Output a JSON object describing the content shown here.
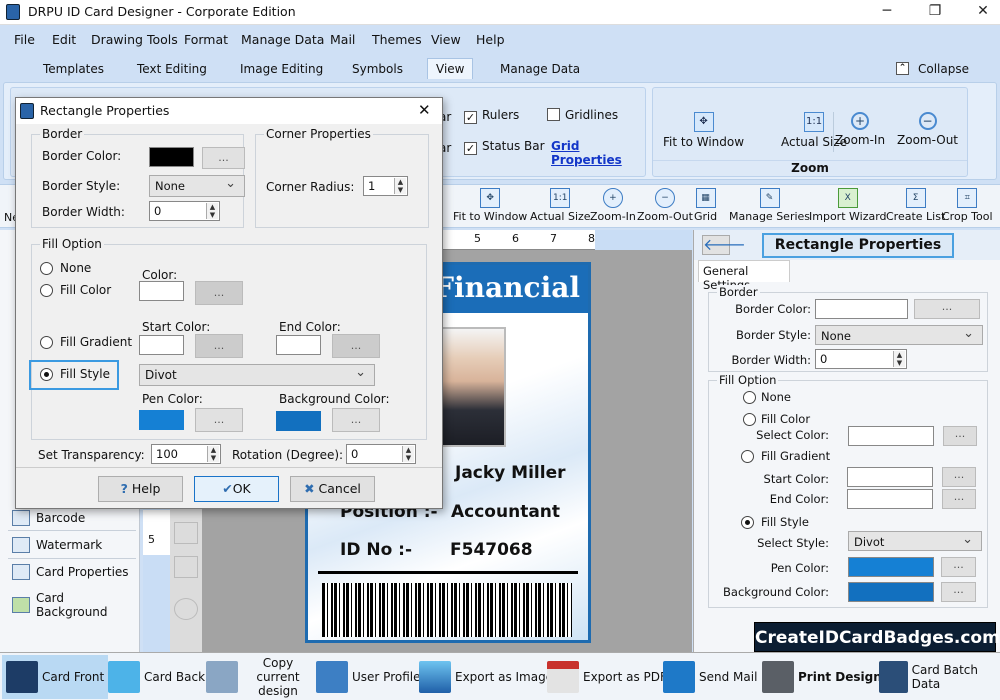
{
  "window": {
    "title": "DRPU ID Card Designer - Corporate Edition",
    "minimize": "─",
    "maximize": "❐",
    "close": "✕"
  },
  "menu": [
    "File",
    "Edit",
    "Drawing Tools",
    "Format",
    "Manage Data",
    "Mail",
    "Themes",
    "View",
    "Help"
  ],
  "tabs": [
    "Templates",
    "Text Editing",
    "Image Editing",
    "Symbols",
    "View",
    "Manage Data"
  ],
  "active_tab": "View",
  "collapse_label": "Collapse",
  "ribbon": {
    "view_group": {
      "partial_1": "ar",
      "partial_2": "ar",
      "rulers": {
        "label": "Rulers",
        "checked": true
      },
      "gridlines": {
        "label": "Gridlines",
        "checked": false
      },
      "status_bar": {
        "label": "Status Bar",
        "checked": true
      },
      "grid_properties": "Grid Properties"
    },
    "zoom_group": {
      "title": "Zoom",
      "buttons": [
        "Fit to Window",
        "Actual Size",
        "Zoom-In",
        "Zoom-Out"
      ]
    }
  },
  "toolbar": {
    "partial_left": "Ne",
    "items": [
      "Fit to Window",
      "Actual Size",
      "Zoom-In",
      "Zoom-Out",
      "Grid",
      "Manage Series",
      "Import Wizard",
      "Create List",
      "Crop Tool"
    ]
  },
  "left_panel": {
    "items": [
      "Barcode",
      "Watermark",
      "Card Properties",
      "Card Background"
    ]
  },
  "ruler": {
    "top": [
      "5",
      "6",
      "7",
      "8"
    ],
    "left": "5"
  },
  "card": {
    "header": "Financial",
    "name": "Jacky Miller",
    "position_label": "Position :-",
    "position": "Accountant",
    "id_label": "ID No :-",
    "id": "F547068",
    "header_color": "#1b6db8"
  },
  "right_panel": {
    "title": "Rectangle Properties",
    "tab": "General Settings",
    "border": {
      "legend": "Border",
      "color_label": "Border Color:",
      "style_label": "Border Style:",
      "style": "None",
      "width_label": "Border Width:",
      "width": "0"
    },
    "fill": {
      "legend": "Fill Option",
      "none": "None",
      "fill_color": "Fill Color",
      "select_color": "Select Color:",
      "fill_gradient": "Fill Gradient",
      "start_color": "Start Color:",
      "end_color": "End Color:",
      "fill_style": "Fill Style",
      "select_style": "Select Style:",
      "style": "Divot",
      "pen_color": "Pen Color:",
      "background_color": "Background Color:",
      "selected": "Fill Style",
      "pen_hex": "#1580d4",
      "bg_hex": "#1270bf"
    },
    "dots": "...",
    "logo": "CreateIDCardBadges.com"
  },
  "dialog": {
    "title": "Rectangle Properties",
    "close": "✕",
    "border": {
      "legend": "Border",
      "color_label": "Border Color:",
      "color_hex": "#000000",
      "style_label": "Border Style:",
      "style": "None",
      "width_label": "Border Width:",
      "width": "0"
    },
    "corner": {
      "legend": "Corner Properties",
      "radius_label": "Corner Radius:",
      "radius": "1"
    },
    "fill": {
      "legend": "Fill Option",
      "none": "None",
      "fill_color": "Fill Color",
      "color": "Color:",
      "fill_gradient": "Fill Gradient",
      "start_color": "Start Color:",
      "end_color": "End Color:",
      "fill_style": "Fill Style",
      "style": "Divot",
      "pen_color": "Pen Color:",
      "background_color": "Background Color:",
      "selected": "Fill Style",
      "pen_hex": "#1580d4",
      "bg_hex": "#1270bf"
    },
    "transparency_label": "Set Transparency:",
    "transparency": "100",
    "rotation_label": "Rotation (Degree):",
    "rotation": "0",
    "dots": "...",
    "buttons": {
      "help": "Help",
      "ok": "OK",
      "cancel": "Cancel"
    }
  },
  "bottom_bar": [
    "Card Front",
    "Card Back",
    "Copy current design",
    "User Profile",
    "Export as Image",
    "Export as PDF",
    "Send Mail",
    "Print Design",
    "Card Batch Data"
  ],
  "active_bottom": "Card Front"
}
